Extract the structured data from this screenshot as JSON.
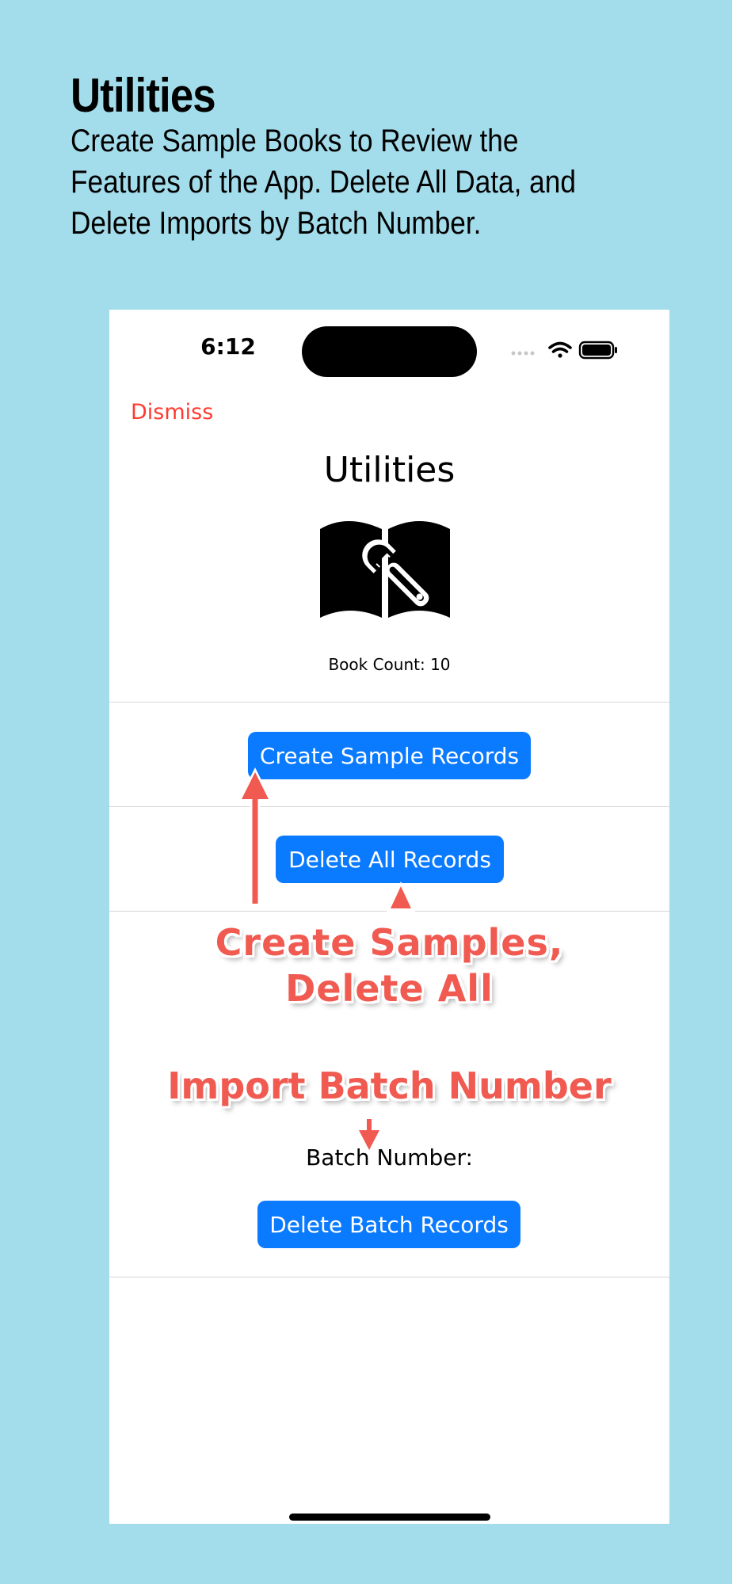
{
  "promo": {
    "title": "Utilities",
    "subtitle": "Create Sample Books to Review the Features of the App. Delete All Data, and Delete Imports by Batch Number."
  },
  "status_bar": {
    "time": "6:12",
    "icons": [
      "signal-icon",
      "wifi-icon",
      "battery-icon"
    ]
  },
  "nav": {
    "dismiss_label": "Dismiss"
  },
  "header": {
    "title": "Utilities",
    "icon": "book-wrench-icon",
    "book_count": "Book Count: 10"
  },
  "actions": {
    "create_sample": "Create Sample Records",
    "delete_all": "Delete All Records",
    "batch_label": "Batch Number:",
    "delete_batch": "Delete Batch Records"
  },
  "annotations": {
    "line1": "Create Samples,",
    "line2": "Delete All",
    "batch": "Import Batch Number"
  },
  "colors": {
    "background": "#a3dcea",
    "accent": "#0a7aff",
    "dismiss": "#ff3b30",
    "annotation": "#f05a50"
  }
}
